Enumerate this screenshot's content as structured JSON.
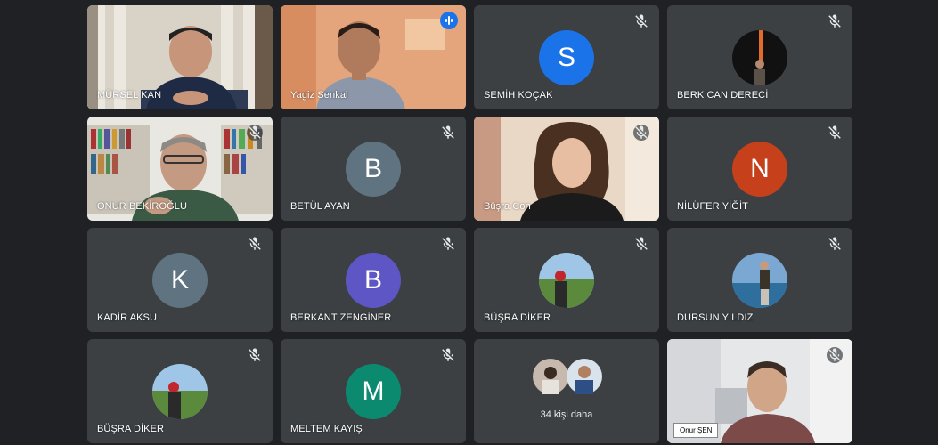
{
  "participants": [
    {
      "name": "MÜRSEL KAN"
    },
    {
      "name": "Yagiz Senkal"
    },
    {
      "name": "SEMİH KOÇAK",
      "initial": "S",
      "color": "#1a73e8"
    },
    {
      "name": "BERK CAN DERECİ"
    },
    {
      "name": "ONUR BEKİROĞLU"
    },
    {
      "name": "BETÜL AYAN",
      "initial": "B",
      "color": "#5f7380"
    },
    {
      "name": "Büşra Con"
    },
    {
      "name": "NİLÜFER YİĞİT",
      "initial": "N",
      "color": "#c5401b"
    },
    {
      "name": "KADİR AKSU",
      "initial": "K",
      "color": "#5f7380"
    },
    {
      "name": "BERKANT ZENGİNER",
      "initial": "B",
      "color": "#5e56c5"
    },
    {
      "name": "BÜŞRA DİKER"
    },
    {
      "name": "DURSUN YILDIZ"
    },
    {
      "name": "BÜŞRA DİKER"
    },
    {
      "name": "MELTEM KAYIŞ",
      "initial": "M",
      "color": "#0b8a70"
    },
    {
      "name": "Onur ŞEN"
    }
  ],
  "overflow": {
    "label": "34 kişi daha"
  },
  "icons": {
    "muted": "mic-off-icon",
    "speaking": "audio-level-icon"
  },
  "colors": {
    "background": "#202124",
    "tile": "#3c4043",
    "active_border": "#8ab4f8"
  }
}
